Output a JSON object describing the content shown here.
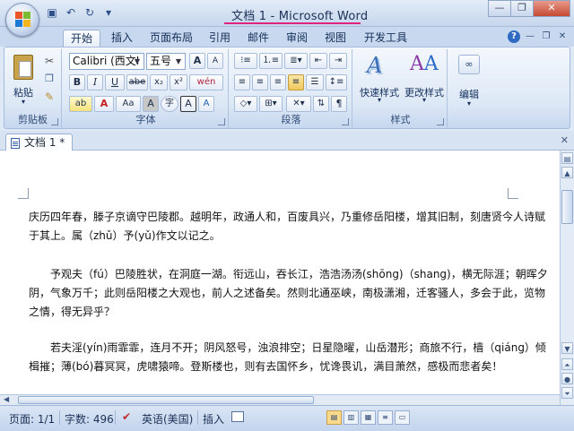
{
  "window": {
    "title": "文档 1 - Microsoft Word",
    "controls": [
      "minimize",
      "restore",
      "close"
    ]
  },
  "quick_access": [
    "save-icon",
    "undo-icon",
    "redo-icon",
    "customize-icon"
  ],
  "tabs": [
    {
      "label": "开始",
      "active": true
    },
    {
      "label": "插入"
    },
    {
      "label": "页面布局"
    },
    {
      "label": "引用"
    },
    {
      "label": "邮件"
    },
    {
      "label": "审阅"
    },
    {
      "label": "视图"
    },
    {
      "label": "开发工具"
    }
  ],
  "ribbon": {
    "clipboard": {
      "label": "剪贴板",
      "paste_label": "粘贴"
    },
    "font": {
      "label": "字体",
      "font_name": "Calibri (西文I",
      "font_size": "五号",
      "bold": "B",
      "italic": "I",
      "underline": "U",
      "strike": "abe",
      "subscript": "x₂",
      "superscript": "x²",
      "clear_format": "A",
      "phonetic": "wén",
      "grow": "A",
      "shrink": "A",
      "highlight": "ab",
      "font_color": "A",
      "change_case": "Aa",
      "char_shade": "A",
      "enclose": "字",
      "char_border": "A"
    },
    "paragraph": {
      "label": "段落"
    },
    "styles": {
      "label": "样式",
      "quick_styles": "快速样式",
      "change_styles": "更改样式"
    },
    "editing": {
      "label": "编辑"
    }
  },
  "document_tab": "文档 1 *",
  "document": {
    "paragraphs": [
      "庆历四年春，滕子京谪守巴陵郡。越明年，政通人和，百废具兴，乃重修岳阳楼，增其旧制，刻唐贤今人诗赋于其上。属（zhǔ）予(yǔ)作文以记之。",
      "予观夫（fú）巴陵胜状，在洞庭一湖。衔远山，吞长江，浩浩汤汤(shōng)（shang)，横无际涯；朝晖夕阴，气象万千；此则岳阳楼之大观也，前人之述备矣。然则北通巫峡，南极潇湘，迁客骚人，多会于此，览物之情，得无异乎？",
      "若夫淫(yín)雨霏霏，连月不开；阴风怒号，浊浪排空；日星隐曜，山岳潜形；商旅不行，樯（qiáng）倾楫摧；薄(bó)暮冥冥，虎啸猿啼。登斯楼也，则有去国怀乡，忧谗畏讥，满目萧然，感极而悲者矣！"
    ]
  },
  "status": {
    "page": "页面: 1/1",
    "words": "字数: 496",
    "language": "英语(美国)",
    "mode": "插入"
  }
}
